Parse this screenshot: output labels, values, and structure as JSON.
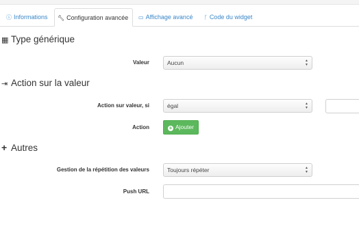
{
  "tabs": [
    {
      "label": "Informations",
      "icon": "info-circle-icon"
    },
    {
      "label": "Configuration avancée",
      "icon": "wrench-icon"
    },
    {
      "label": "Affichage avancé",
      "icon": "desktop-icon"
    },
    {
      "label": "Code du widget",
      "icon": "code-fork-icon"
    }
  ],
  "sections": {
    "type": {
      "title": "Type générique",
      "icon": "building-icon"
    },
    "action": {
      "title": "Action sur la valeur",
      "icon": "sign-in-icon"
    },
    "autres": {
      "title": "Autres",
      "icon": "plus-icon"
    }
  },
  "type_generique": {
    "valeur_label": "Valeur",
    "valeur_value": "Aucun"
  },
  "action_valeur": {
    "condition_label": "Action sur valeur, si",
    "condition_value": "égal",
    "compare_value": "",
    "action_label": "Action",
    "add_button": "Ajouter"
  },
  "autres": {
    "repetition_label": "Gestion de la répétition des valeurs",
    "repetition_value": "Toujours répéter",
    "push_url_label": "Push URL",
    "push_url_value": ""
  },
  "colors": {
    "link": "#3a87c8",
    "success": "#5cb85c"
  }
}
